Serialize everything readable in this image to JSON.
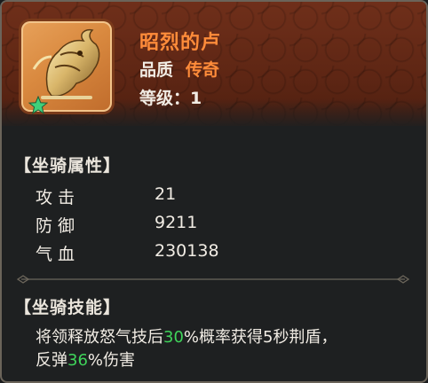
{
  "mount": {
    "name": "昭烈的卢",
    "quality_label": "品质",
    "quality_value": "传奇",
    "level_label": "等级：",
    "level_value": "1"
  },
  "attributes": {
    "title": "【坐骑属性】",
    "items": [
      {
        "label": "攻击",
        "value": "21"
      },
      {
        "label": "防御",
        "value": "9211"
      },
      {
        "label": "气血",
        "value": "230138"
      }
    ]
  },
  "skills": {
    "title": "【坐骑技能】",
    "line1_a": "将领释放怒气技后",
    "line1_pct": "30",
    "line1_b": "%概率获得5秒荆盾，",
    "line2_a": "反弹",
    "line2_pct": "36",
    "line2_b": "%伤害"
  },
  "colors": {
    "quality": "#ff8c3a",
    "highlight": "#3fd45a",
    "star": "#3fd07a"
  },
  "icons": [
    "mount-portrait-icon",
    "star-icon",
    "divider-ornament-icon"
  ]
}
